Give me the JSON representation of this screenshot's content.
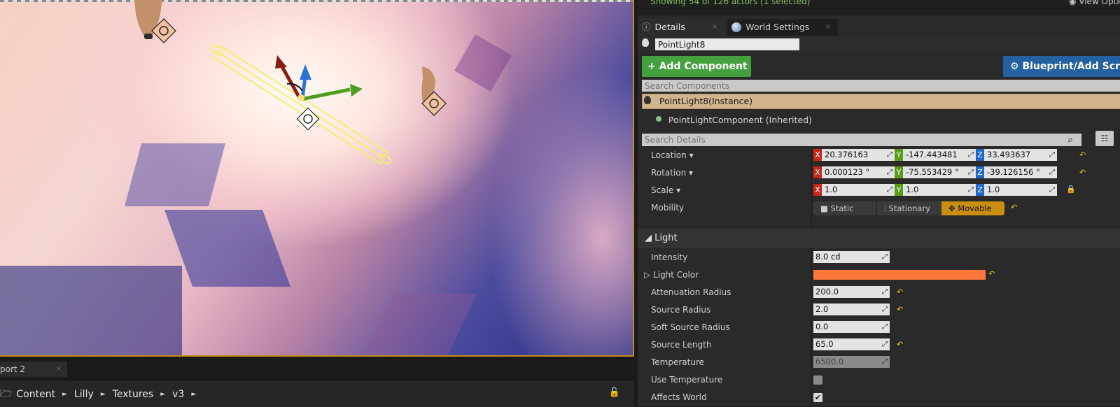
{
  "viewport": {
    "tab_label": "port 2",
    "tab_close": "×"
  },
  "content_browser": {
    "crumbs": [
      "Content",
      "Lilly",
      "Textures",
      "v3"
    ],
    "sep": "►"
  },
  "outliner": {
    "showing": "Showing 54 of 126 actors (1 selected)",
    "view_options": "View Optio"
  },
  "tabs": [
    {
      "label": "Details",
      "close": "×"
    },
    {
      "label": "World Settings",
      "close": "×"
    }
  ],
  "actor_name": "PointLight8",
  "add_component_label": "+ Add Component ▾",
  "blueprint_label": "Blueprint/Add Scrip",
  "search_components_placeholder": "Search Components",
  "instance_label": "PointLight8(Instance)",
  "component_label": "PointLightComponent (Inherited)",
  "search_details_placeholder": "Search Details",
  "transform": {
    "location": {
      "label": "Location ▾",
      "x": "20.376163",
      "y": "-147.443481",
      "z": "33.493637"
    },
    "rotation": {
      "label": "Rotation ▾",
      "x": "0.000123 °",
      "y": "-75.553429 °",
      "z": "-39.126156 °"
    },
    "scale": {
      "label": "Scale ▾",
      "x": "1.0",
      "y": "1.0",
      "z": "1.0"
    },
    "mobility": {
      "label": "Mobility",
      "options": [
        "Static",
        "Stationary",
        "Movable"
      ],
      "selected": "Movable"
    }
  },
  "light_section": "◢ Light",
  "light": {
    "intensity": {
      "label": "Intensity",
      "value": "8.0 cd"
    },
    "light_color": {
      "label": "▷ Light Color",
      "color": "#ff773a"
    },
    "attenuation_radius": {
      "label": "Attenuation Radius",
      "value": "200.0"
    },
    "source_radius": {
      "label": "Source Radius",
      "value": "2.0"
    },
    "soft_source_radius": {
      "label": "Soft Source Radius",
      "value": "0.0"
    },
    "source_length": {
      "label": "Source Length",
      "value": "65.0"
    },
    "temperature": {
      "label": "Temperature",
      "value": "6500.0"
    },
    "use_temperature": {
      "label": "Use Temperature",
      "checked": false
    },
    "affects_world": {
      "label": "Affects World",
      "checked": true
    }
  },
  "colors": {
    "accent_green": "#45a13e",
    "accent_blue": "#2361a0",
    "selection_orange": "#c98f10"
  }
}
